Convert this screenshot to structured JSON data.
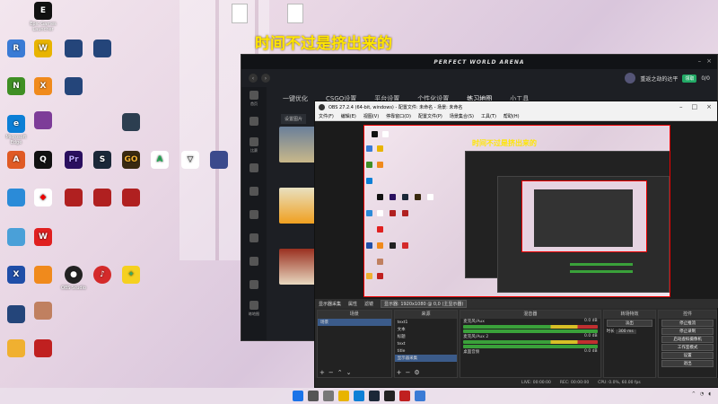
{
  "caption": "时间不过是挤出来的",
  "pwa": {
    "brand": "PERFECT WORLD ARENA",
    "username": "重返之劫的达平",
    "badge": "领取",
    "count": "0/0",
    "tabs": [
      "一键优化",
      "CSGO设置",
      "平台设置",
      "个性化设置",
      "练习地图",
      "小工具"
    ],
    "filter": "设置图片",
    "side_labels": [
      "首页",
      "",
      "比赛",
      "",
      "",
      "",
      "",
      "",
      "",
      "练地图"
    ]
  },
  "obs": {
    "title": "OBS 27.2.4 (64-bit, windows) - 配置文件: 未命名 - 场景: 未命名",
    "menu": [
      "文件(F)",
      "编辑(E)",
      "视图(V)",
      "停靠窗口(D)",
      "配置文件(P)",
      "场景集合(S)",
      "工具(T)",
      "帮助(H)"
    ],
    "nested_caption": "时间不过是挤出来的",
    "status": {
      "source": "显示器采集",
      "props": "属性",
      "filter": "滤镜",
      "display": "显示器: 1920x1080 @ 0,0 (主显示器)"
    },
    "docks": {
      "scenes_title": "场景",
      "scenes": [
        "场景"
      ],
      "sources_title": "来源",
      "sources": [
        "text1",
        "文本",
        "标题",
        "text",
        "title",
        "显示器采集"
      ],
      "mixer_title": "混音器",
      "mixer": [
        {
          "name": "麦克风/Aux",
          "db": "0.0 dB"
        },
        {
          "name": "麦克风/Aux 2",
          "db": "0.0 dB"
        },
        {
          "name": "桌面音频",
          "db": "0.0 dB"
        }
      ],
      "transition_title": "转场特效",
      "transition": "淡出",
      "duration_label": "时长",
      "duration": "300 ms",
      "controls_title": "控件",
      "controls": [
        "停止推流",
        "停止录制",
        "启动虚拟摄像机",
        "工作室模式",
        "设置",
        "退出"
      ]
    },
    "footer": {
      "live": "LIVE: 00:00:00",
      "rec": "REC: 00:00:00",
      "cpu": "CPU: 0.0%, 60.00 fps"
    }
  },
  "desktop": {
    "icons": [
      "Epic Games Launcher",
      "RPA工具",
      "WPS Office",
      "Premiere Pro",
      "Adobe Premiere",
      "Steam",
      "Counter-Strike",
      "Cortex",
      "完美世界竞技平台",
      "有道翻译",
      "腾讯QQ",
      "网易云音乐",
      "OBS Studio",
      "迅雷",
      "原神",
      "Microsoft Edge",
      "GeForce Experience",
      "迅游加速器",
      "AnyDesk",
      "此电脑"
    ]
  }
}
